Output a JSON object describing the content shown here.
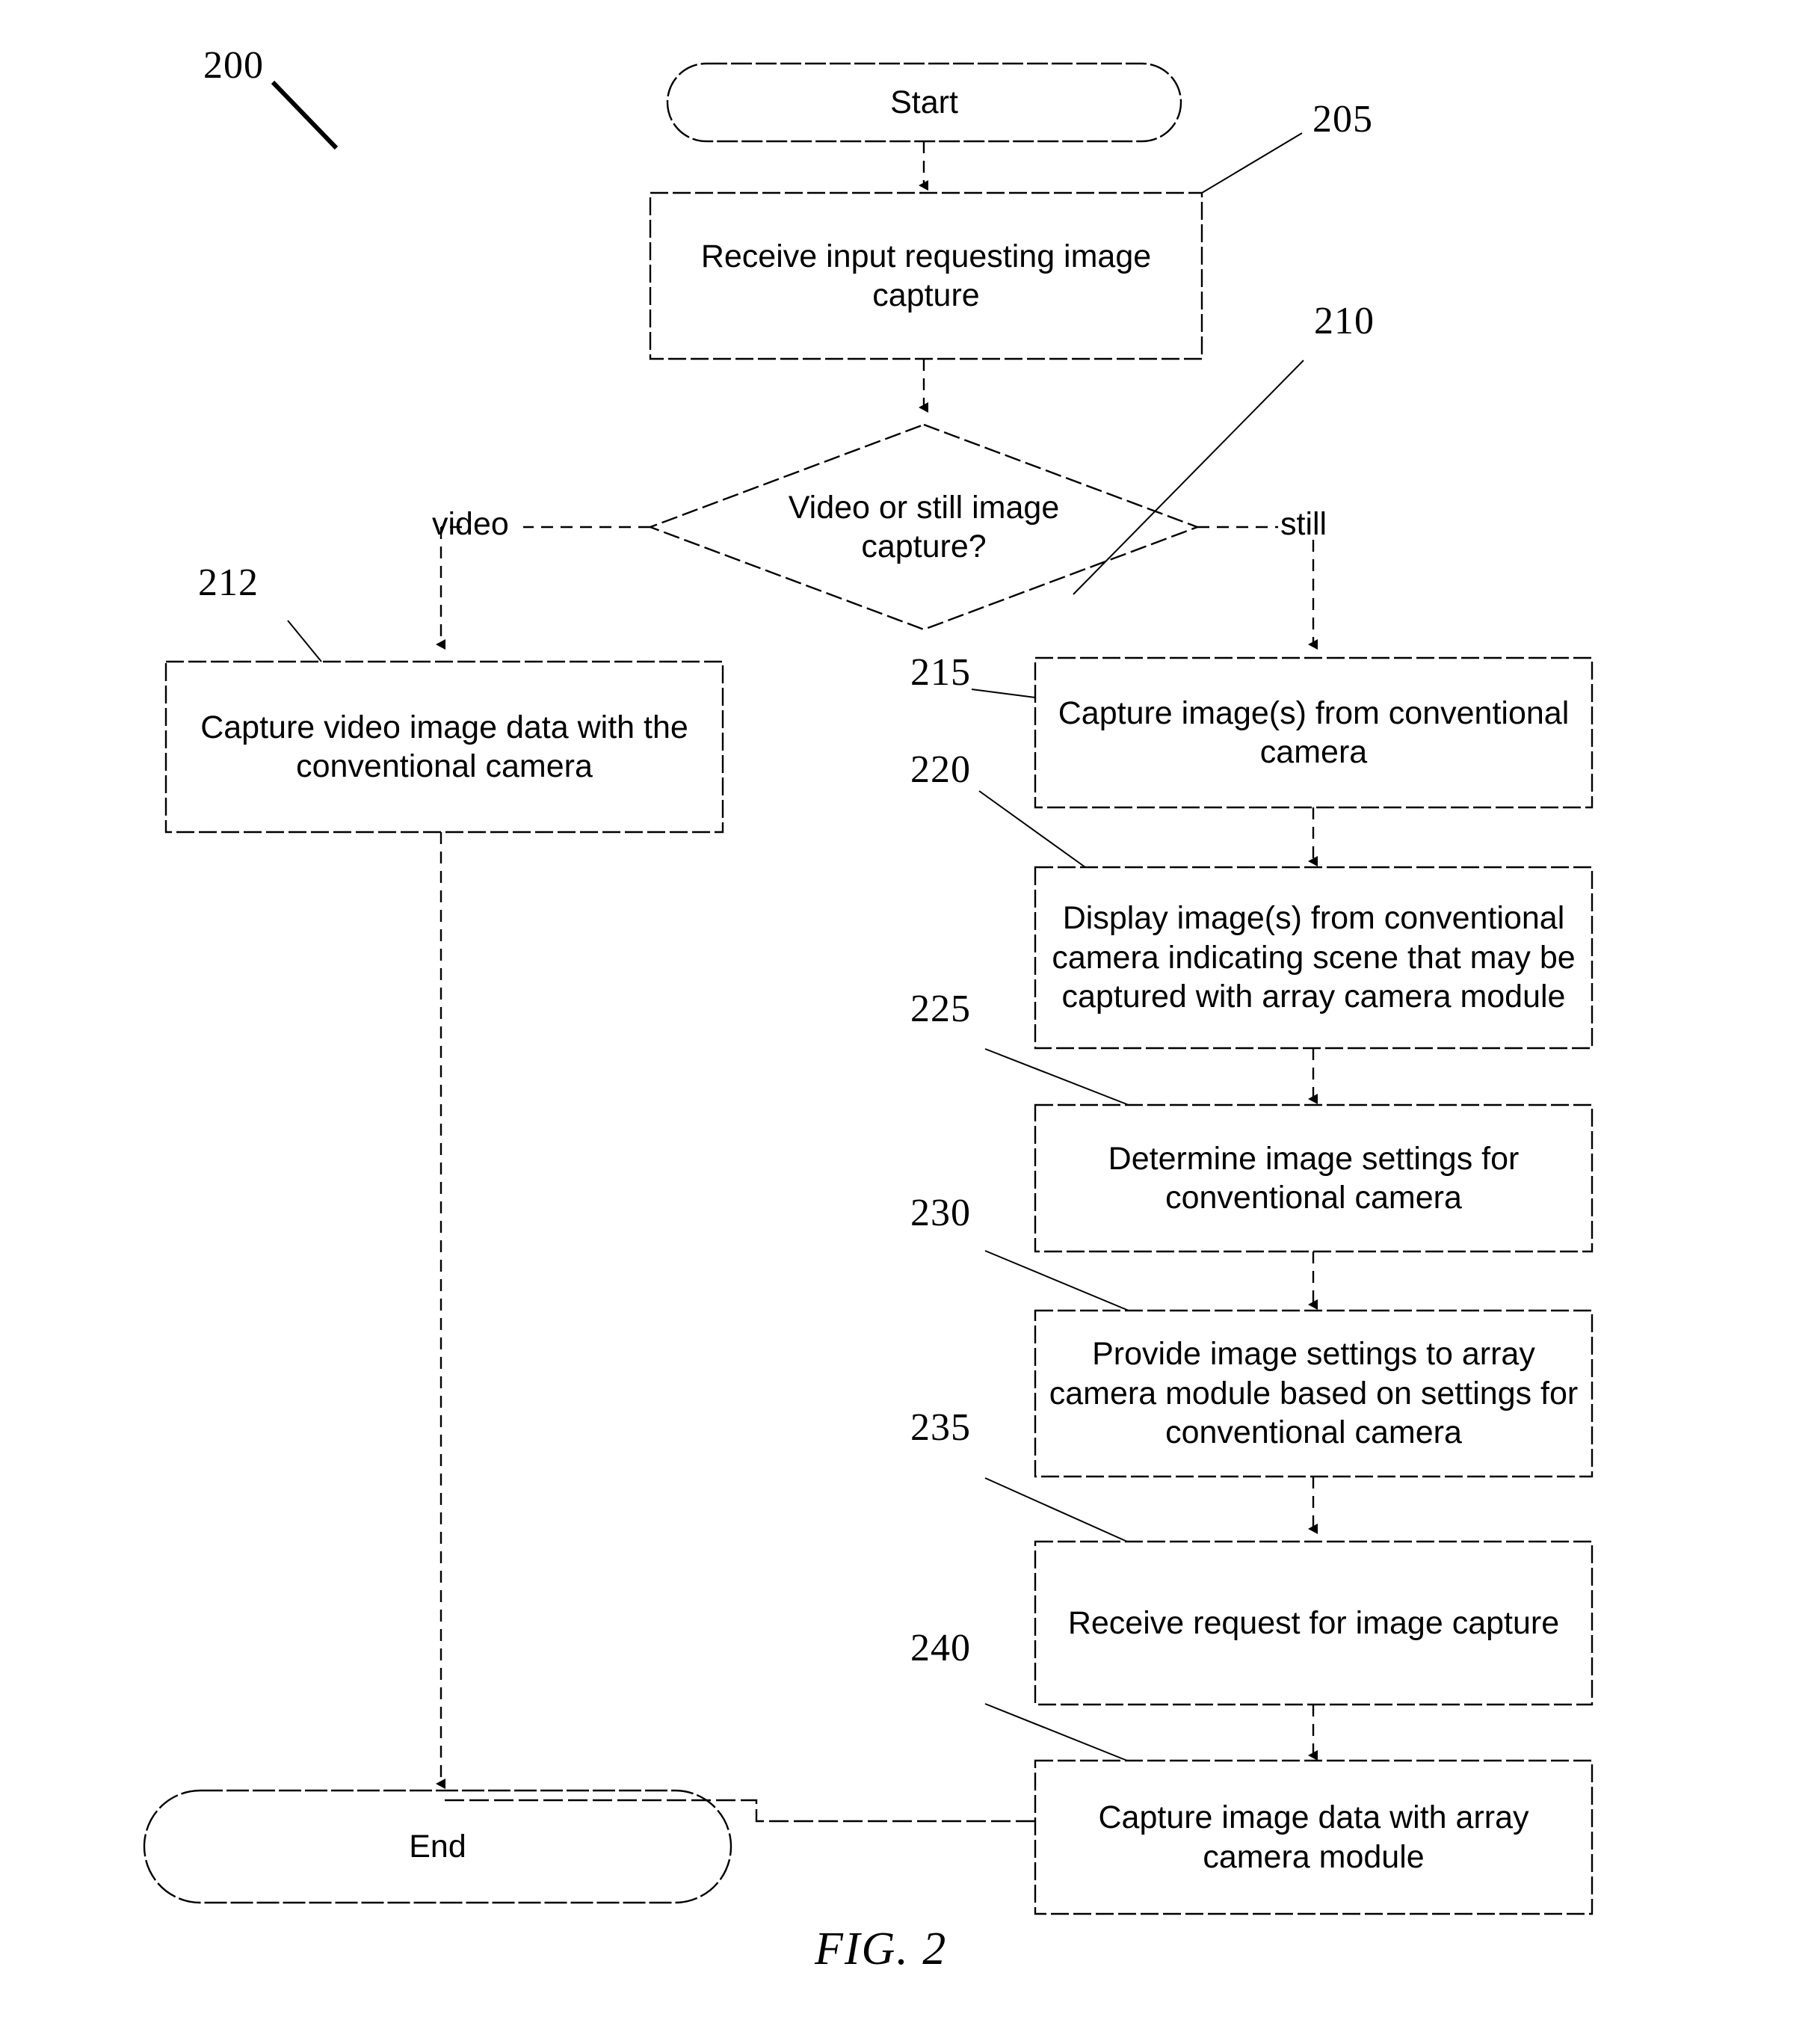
{
  "figure": {
    "caption": "FIG. 2",
    "diagram_ref": "200"
  },
  "nodes": {
    "start": {
      "label": "Start",
      "shape": "stadium"
    },
    "n205": {
      "ref": "205",
      "label": "Receive input requesting image capture",
      "shape": "rect"
    },
    "n210": {
      "ref": "210",
      "label": "Video or still image capture?",
      "shape": "diamond"
    },
    "n212": {
      "ref": "212",
      "label": "Capture video image data with the conventional camera",
      "shape": "rect"
    },
    "n215": {
      "ref": "215",
      "label": "Capture image(s)  from conventional camera",
      "shape": "rect"
    },
    "n220": {
      "ref": "220",
      "label": "Display image(s) from conventional camera indicating scene that may be captured with array camera module",
      "shape": "rect"
    },
    "n225": {
      "ref": "225",
      "label": "Determine image settings for conventional camera",
      "shape": "rect"
    },
    "n230": {
      "ref": "230",
      "label": "Provide image settings to array camera module  based on settings for conventional camera",
      "shape": "rect"
    },
    "n235": {
      "ref": "235",
      "label": "Receive request for image capture",
      "shape": "rect"
    },
    "n240": {
      "ref": "240",
      "label": "Capture image data with array camera module",
      "shape": "rect"
    },
    "end": {
      "label": "End",
      "shape": "stadium"
    }
  },
  "edge_labels": {
    "video": "video",
    "still": "still"
  },
  "colors": {
    "stroke": "#000000",
    "fill": "#ffffff",
    "text": "#000000"
  }
}
